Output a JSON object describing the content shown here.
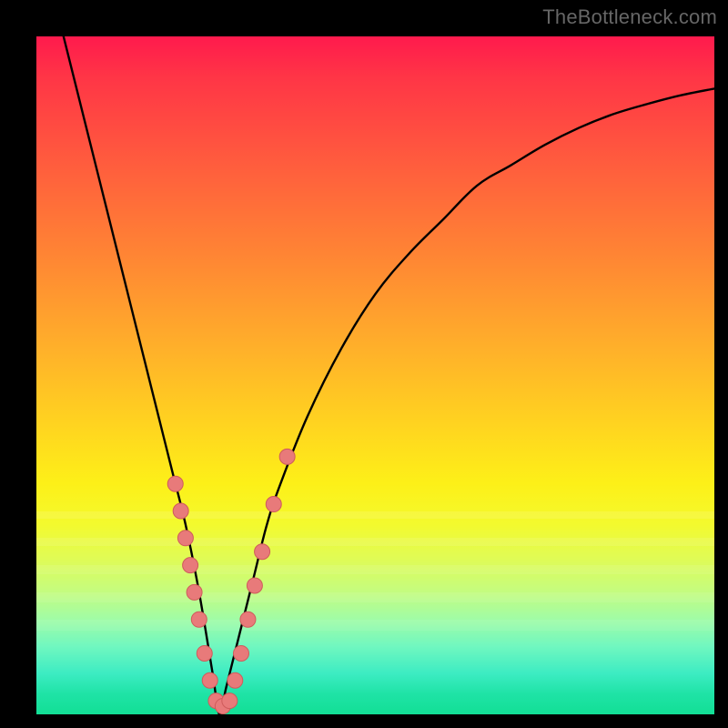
{
  "watermark": "TheBottleneck.com",
  "colors": {
    "curve": "#000000",
    "marker_fill": "#e87a7a",
    "marker_stroke": "#cf5b5b",
    "bg_black": "#000000"
  },
  "chart_data": {
    "type": "line",
    "title": "",
    "xlabel": "",
    "ylabel": "",
    "xlim": [
      0,
      100
    ],
    "ylim": [
      0,
      100
    ],
    "note": "V-shaped bottleneck curve; x and y axes are percentage-like (0–100). Minimum sits near x≈27 at y≈0. Salmon markers cluster along the curve roughly between y≈3 and y≈40 on both arms.",
    "series": [
      {
        "name": "bottleneck-curve",
        "x": [
          4,
          6,
          8,
          10,
          12,
          14,
          16,
          18,
          20,
          22,
          24,
          26,
          27,
          28,
          30,
          32,
          34,
          36,
          40,
          45,
          50,
          55,
          60,
          65,
          70,
          75,
          80,
          85,
          90,
          95,
          100
        ],
        "y": [
          100,
          92,
          84,
          76,
          68,
          60,
          52,
          44,
          36,
          28,
          18,
          6,
          0,
          4,
          12,
          20,
          28,
          34,
          44,
          54,
          62,
          68,
          73,
          78,
          81,
          84,
          86.5,
          88.5,
          90,
          91.3,
          92.3
        ]
      }
    ],
    "markers": {
      "name": "highlighted-points",
      "points": [
        {
          "x": 20.5,
          "y": 34
        },
        {
          "x": 21.3,
          "y": 30
        },
        {
          "x": 22.0,
          "y": 26
        },
        {
          "x": 22.7,
          "y": 22
        },
        {
          "x": 23.3,
          "y": 18
        },
        {
          "x": 24.0,
          "y": 14
        },
        {
          "x": 24.8,
          "y": 9
        },
        {
          "x": 25.6,
          "y": 5
        },
        {
          "x": 26.5,
          "y": 2
        },
        {
          "x": 27.5,
          "y": 1.2
        },
        {
          "x": 28.5,
          "y": 2
        },
        {
          "x": 29.3,
          "y": 5
        },
        {
          "x": 30.2,
          "y": 9
        },
        {
          "x": 31.2,
          "y": 14
        },
        {
          "x": 32.2,
          "y": 19
        },
        {
          "x": 33.3,
          "y": 24
        },
        {
          "x": 35.0,
          "y": 31
        },
        {
          "x": 37.0,
          "y": 38
        }
      ]
    },
    "band_streaks_y": [
      70,
      74,
      78,
      82,
      86
    ]
  }
}
